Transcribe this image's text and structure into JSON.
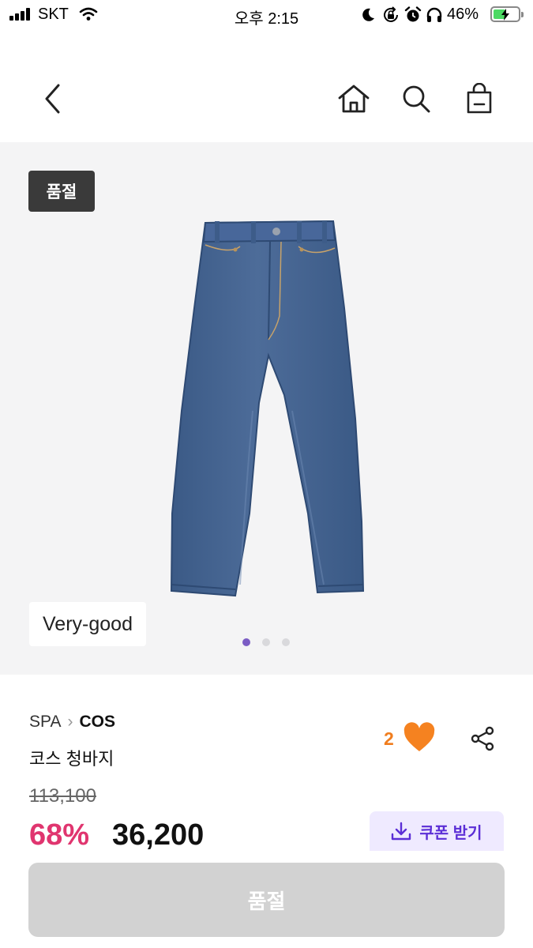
{
  "status_bar": {
    "carrier": "SKT",
    "time": "오후 2:15",
    "battery_percent": "46%",
    "icons": [
      "signal-icon",
      "wifi-icon",
      "moon-icon",
      "orientation-lock-icon",
      "alarm-icon",
      "headphones-icon",
      "battery-charging-icon"
    ]
  },
  "nav": {
    "icons": [
      "back-chevron-icon",
      "home-icon",
      "search-icon",
      "shopping-bag-icon"
    ]
  },
  "gallery": {
    "badge": "품절",
    "condition": "Very-good",
    "page_count": 3,
    "active_page": 1,
    "active_dot_color": "#7b5cc4",
    "background_color": "#f4f4f5"
  },
  "product": {
    "category": "SPA",
    "brand": "COS",
    "name": "코스 청바지",
    "like_count": "2",
    "original_price": "113,100",
    "discount": "68%",
    "price": "36,200",
    "coupon_label": "쿠폰 받기"
  },
  "bottom": {
    "buy_label": "품절"
  },
  "colors": {
    "discount": "#e0356f",
    "heart": "#f58220",
    "coupon_text": "#5b2ed6",
    "coupon_bg": "#efeaff",
    "soldout_badge": "#3a3a3a",
    "disabled_button": "#d2d2d2"
  }
}
